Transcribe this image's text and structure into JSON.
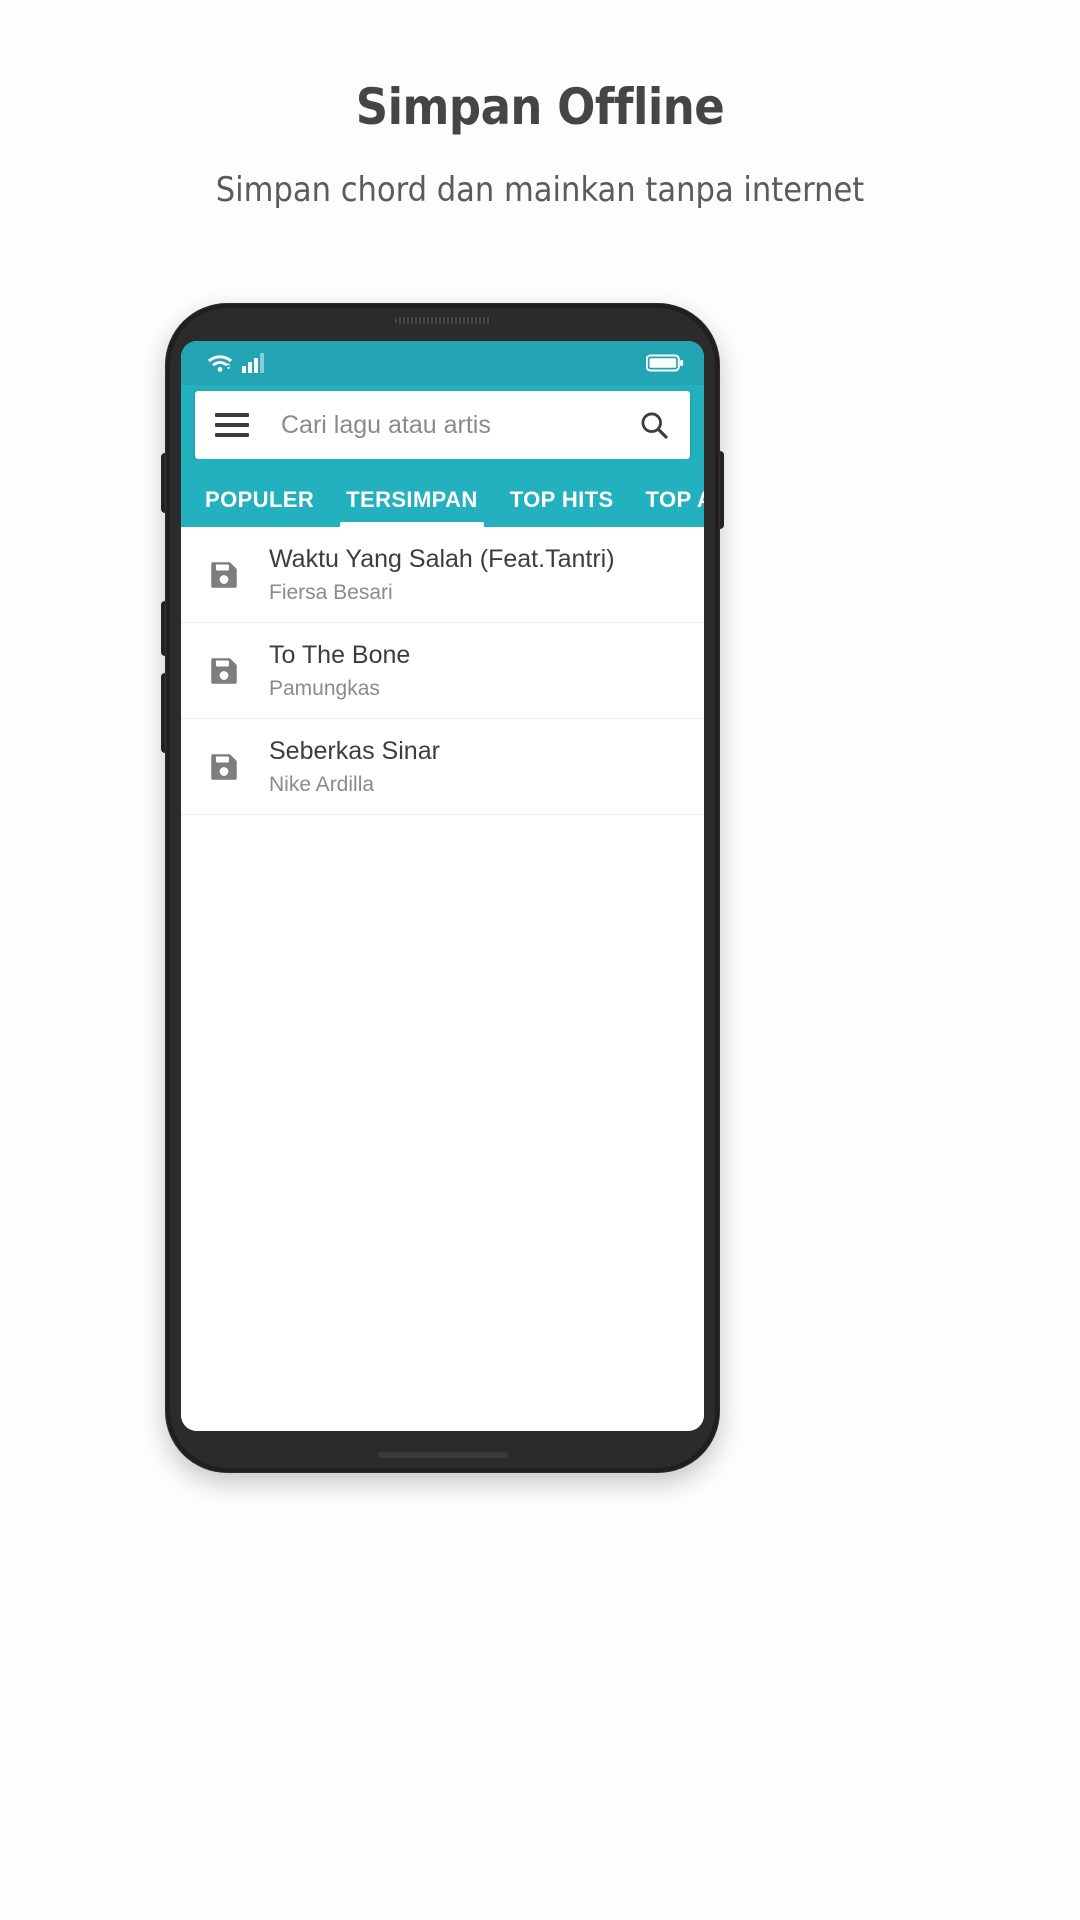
{
  "promo": {
    "headline": "Simpan Offline",
    "subheadline": "Simpan chord dan mainkan tanpa internet"
  },
  "colors": {
    "accent": "#23b1bf",
    "statusbar": "#23a4b2",
    "phone_frame": "#1f1f1f",
    "title_text": "#454545",
    "row_title": "#3d3d3d",
    "row_subtitle": "#8b8b8b",
    "placeholder": "#8a8a8a"
  },
  "phone": {
    "statusbar": {
      "wifi_icon": "wifi-icon",
      "signal_icon": "cellular-signal-icon",
      "battery_icon": "battery-icon"
    },
    "appbar": {
      "menu_icon": "hamburger-menu-icon",
      "search_icon": "search-icon",
      "search_value": "",
      "search_placeholder": "Cari lagu atau artis"
    },
    "tabs": [
      {
        "label": "POPULER",
        "active": false
      },
      {
        "label": "TERSIMPAN",
        "active": true
      },
      {
        "label": "TOP HITS",
        "active": false
      },
      {
        "label": "TOP ARTIS",
        "active": false
      }
    ],
    "list": [
      {
        "icon": "save-floppy-icon",
        "title": "Waktu Yang Salah (Feat.Tantri)",
        "artist": "Fiersa Besari"
      },
      {
        "icon": "save-floppy-icon",
        "title": "To The Bone",
        "artist": "Pamungkas"
      },
      {
        "icon": "save-floppy-icon",
        "title": "Seberkas Sinar",
        "artist": "Nike Ardilla"
      }
    ]
  }
}
